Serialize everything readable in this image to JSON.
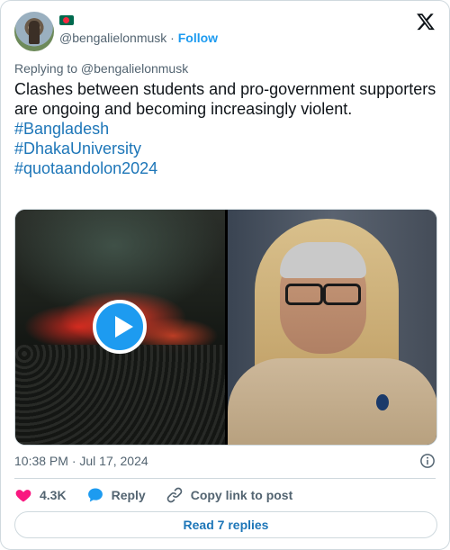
{
  "header": {
    "handle": "@bengalielonmusk",
    "separator": "·",
    "follow_label": "Follow",
    "flag_icon": "bangladesh-flag-emoji",
    "logo_icon": "x-logo-icon"
  },
  "tweet": {
    "replying_to": "Replying to @bengalielonmusk",
    "body": "Clashes between students and pro-government supporters are ongoing and becoming increasingly violent.",
    "hashtags": [
      "#Bangladesh",
      "#DhakaUniversity",
      "#quotaandolon2024"
    ]
  },
  "media": {
    "left": {
      "kind": "video",
      "play_icon": "play-icon"
    },
    "right": {
      "kind": "photo"
    }
  },
  "meta": {
    "timestamp": "10:38 PM · Jul 17, 2024",
    "info_icon": "info-icon"
  },
  "actions": {
    "like_count": "4.3K",
    "reply_label": "Reply",
    "copy_label": "Copy link to post"
  },
  "footer": {
    "read_replies_label": "Read 7 replies"
  },
  "colors": {
    "link": "#1d76b8",
    "follow": "#1d9bf0",
    "like": "#f91880",
    "reply": "#1d9bf0",
    "secondary_text": "#536471",
    "border": "#cfd9de"
  }
}
